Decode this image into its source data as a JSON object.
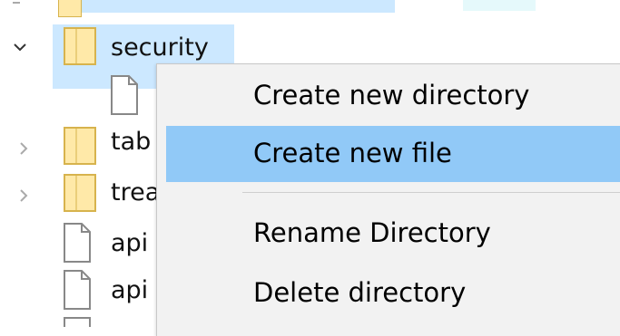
{
  "tree": {
    "security_folder": {
      "label": "security",
      "expanded": true,
      "selected": true
    },
    "child_file": {
      "label": ""
    },
    "items": [
      {
        "label": "tab",
        "kind": "folder",
        "expanded": false
      },
      {
        "label": "trea",
        "kind": "folder",
        "expanded": false
      },
      {
        "label": "api",
        "kind": "file"
      },
      {
        "label": "api",
        "kind": "file"
      }
    ]
  },
  "context_menu": {
    "items": [
      {
        "label": "Create new directory",
        "highlighted": false
      },
      {
        "label": "Create new file",
        "highlighted": true
      },
      {
        "label": "Rename Directory",
        "highlighted": false
      },
      {
        "label": "Delete directory",
        "highlighted": false
      }
    ]
  },
  "colors": {
    "selection": "#cce8ff",
    "menu_highlight": "#91c9f7",
    "menu_background": "#f2f2f2",
    "folder_fill": "#ffe9a8",
    "folder_stroke": "#d7b34d"
  },
  "icons": {
    "expanded": "chevron-down-icon",
    "collapsed": "chevron-right-icon",
    "folder": "folder-icon",
    "file": "file-icon"
  }
}
